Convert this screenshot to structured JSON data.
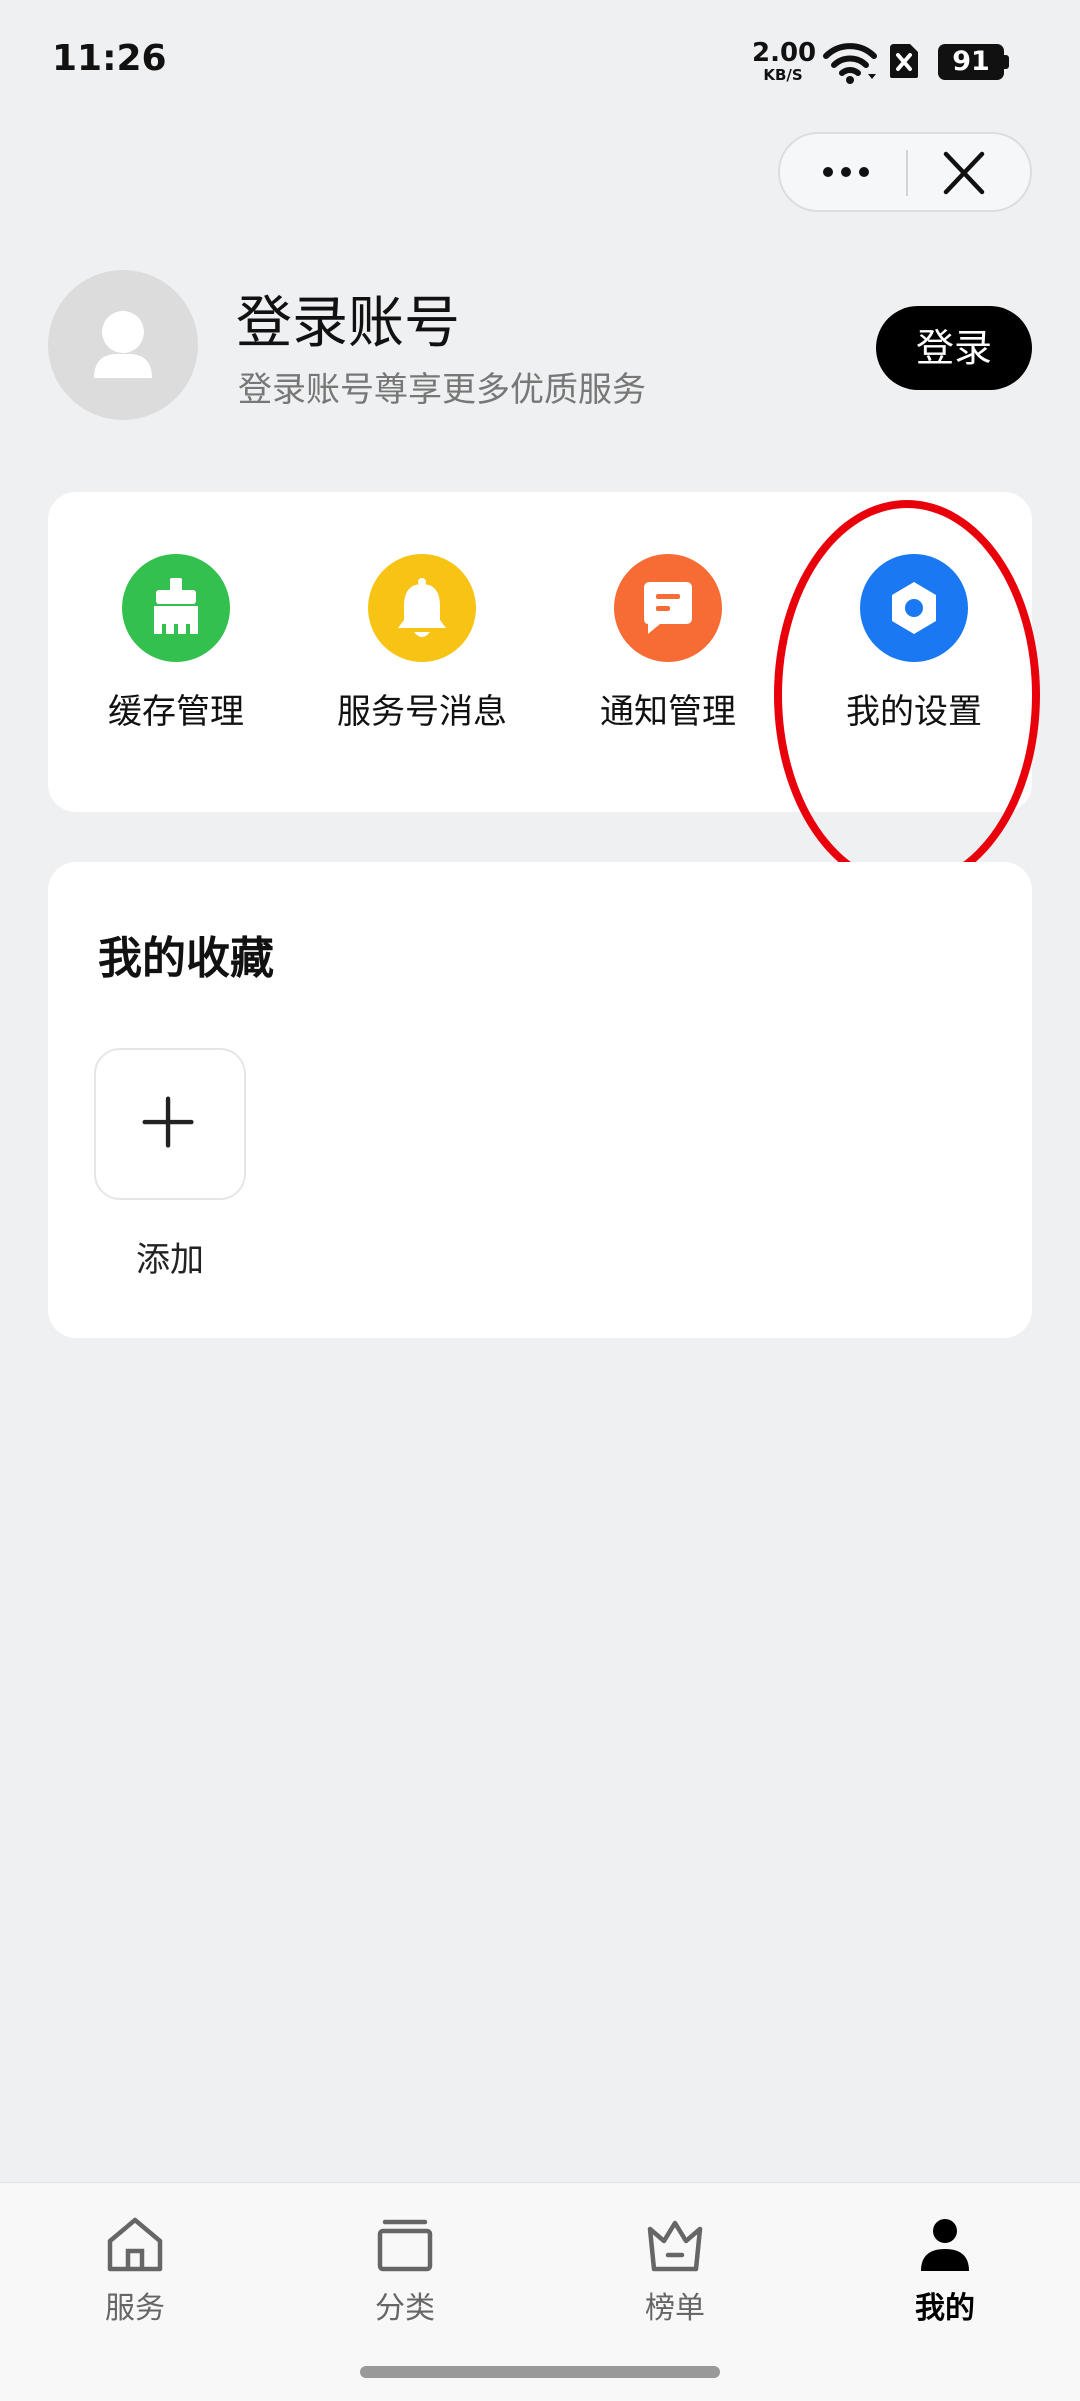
{
  "status_bar": {
    "time": "11:26",
    "net_speed_value": "2.00",
    "net_speed_unit": "KB/S",
    "battery": "91"
  },
  "capsule": {
    "more_icon": "more-icon",
    "close_icon": "close-icon"
  },
  "profile": {
    "title": "登录账号",
    "subtitle": "登录账号尊享更多优质服务",
    "login_label": "登录"
  },
  "quick_actions": [
    {
      "label": "缓存管理",
      "icon": "brush-icon",
      "color": "#34c04f"
    },
    {
      "label": "服务号消息",
      "icon": "bell-icon",
      "color": "#f7c415"
    },
    {
      "label": "通知管理",
      "icon": "message-icon",
      "color": "#f76b34"
    },
    {
      "label": "我的设置",
      "icon": "settings-icon",
      "color": "#1a78f2"
    }
  ],
  "favorites": {
    "title": "我的收藏",
    "add_label": "添加"
  },
  "tabbar": {
    "items": [
      {
        "label": "服务",
        "icon": "home-icon"
      },
      {
        "label": "分类",
        "icon": "category-icon"
      },
      {
        "label": "榜单",
        "icon": "crown-icon"
      },
      {
        "label": "我的",
        "icon": "person-icon",
        "active": true
      }
    ]
  },
  "highlight_color": "#e8000b"
}
